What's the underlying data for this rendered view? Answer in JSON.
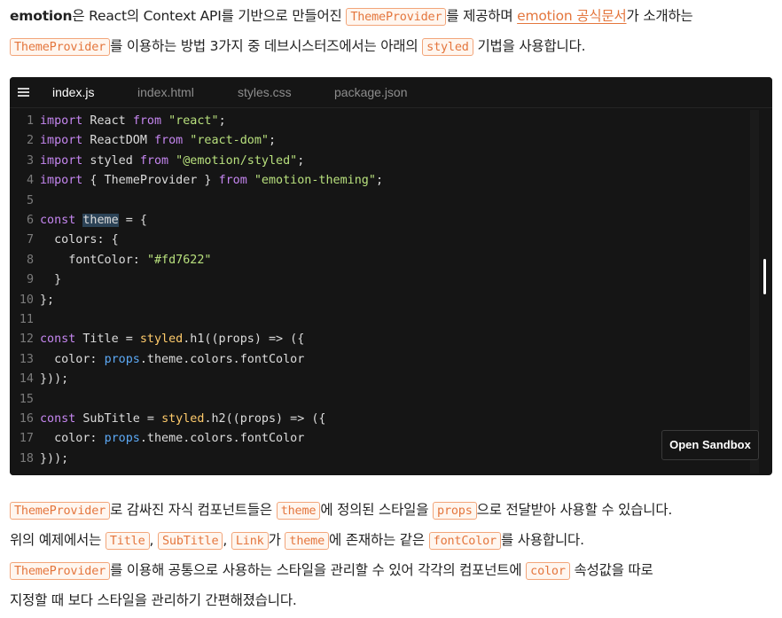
{
  "intro": {
    "brand": "emotion",
    "t1": "은 React의 Context API를 기반으로 만들어진 ",
    "tag1": "ThemeProvider",
    "t2": "를 제공하며 ",
    "link": "emotion 공식문서",
    "t3": "가 소개하는",
    "tag2": "ThemeProvider",
    "t4": "를 이용하는 방법 3가지 중 데브시스터즈에서는 아래의 ",
    "tag3": "styled",
    "t5": " 기법을 사용합니다."
  },
  "sandbox": {
    "tabs": [
      "index.js",
      "index.html",
      "styles.css",
      "package.json"
    ],
    "open_button": "Open Sandbox",
    "code": {
      "l1": {
        "n": "1",
        "a": "import",
        "b": " React ",
        "c": "from",
        "d": " \"react\"",
        "e": ";"
      },
      "l2": {
        "n": "2",
        "a": "import",
        "b": " ReactDOM ",
        "c": "from",
        "d": " \"react-dom\"",
        "e": ";"
      },
      "l3": {
        "n": "3",
        "a": "import",
        "b": " styled ",
        "c": "from",
        "d": " \"@emotion/styled\"",
        "e": ";"
      },
      "l4": {
        "n": "4",
        "a": "import",
        "b": " { ThemeProvider } ",
        "c": "from",
        "d": " \"emotion-theming\"",
        "e": ";"
      },
      "l5": {
        "n": "5"
      },
      "l6": {
        "n": "6",
        "a": "const",
        "b": "theme",
        "c": " = {"
      },
      "l7": {
        "n": "7",
        "a": "  colors: {"
      },
      "l8": {
        "n": "8",
        "a": "    fontColor: ",
        "b": "\"#fd7622\""
      },
      "l9": {
        "n": "9",
        "a": "  }"
      },
      "l10": {
        "n": "10",
        "a": "};"
      },
      "l11": {
        "n": "11"
      },
      "l12": {
        "n": "12",
        "a": "const",
        "b": " Title = ",
        "c": "styled",
        "d": ".h1((props) => ({"
      },
      "l13": {
        "n": "13",
        "a": "  color: ",
        "b": "props",
        "c": ".theme.colors.fontColor"
      },
      "l14": {
        "n": "14",
        "a": "}));"
      },
      "l15": {
        "n": "15"
      },
      "l16": {
        "n": "16",
        "a": "const",
        "b": " SubTitle = ",
        "c": "styled",
        "d": ".h2((props) => ({"
      },
      "l17": {
        "n": "17",
        "a": "  color: ",
        "b": "props",
        "c": ".theme.colors.fontColor"
      },
      "l18": {
        "n": "18",
        "a": "}));"
      }
    }
  },
  "outro": {
    "p1": {
      "tag": "ThemeProvider",
      "t1": "로 감싸진 자식 컴포넌트들은 ",
      "tag2": "theme",
      "t2": "에 정의된 스타일을 ",
      "tag3": "props",
      "t3": "으로 전달받아 사용할 수 있습니다."
    },
    "p2": {
      "t0": "위의 예제에서는 ",
      "tag1": "Title",
      "c1": ", ",
      "tag2": "SubTitle",
      "c2": ", ",
      "tag3": "Link",
      "t1": "가 ",
      "tag4": "theme",
      "t2": "에 존재하는 같은 ",
      "tag5": "fontColor",
      "t3": "를 사용합니다."
    },
    "p3": {
      "tag": "ThemeProvider",
      "t1": "를 이용해 공통으로 사용하는 스타일을 관리할 수 있어 각각의 컴포넌트에 ",
      "tag2": "color",
      "t2": " 속성값을 따로"
    },
    "p4": {
      "t": "지정할 때 보다 스타일을 관리하기 간편해졌습니다."
    }
  }
}
